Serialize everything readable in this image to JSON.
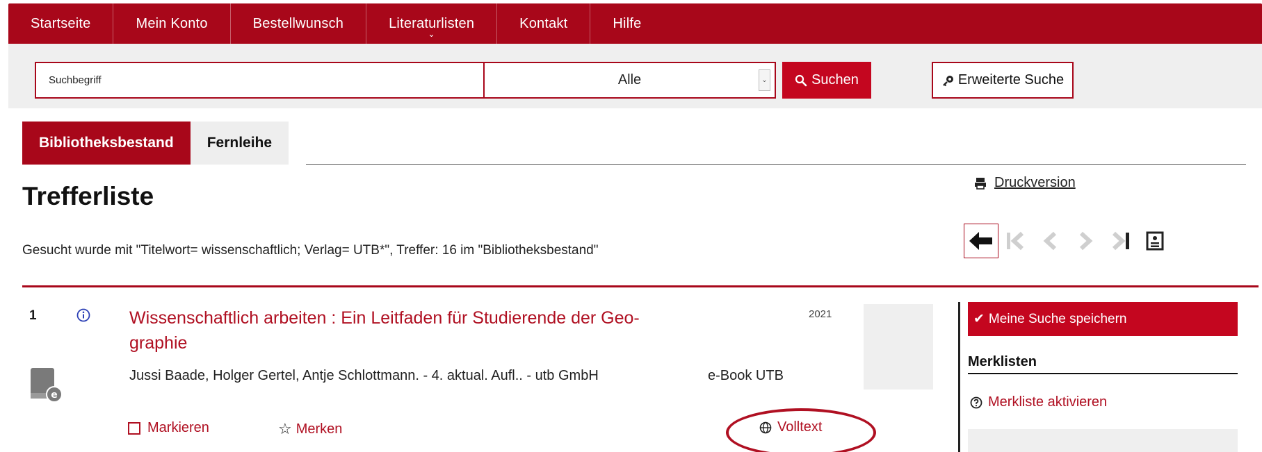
{
  "nav": {
    "items": [
      {
        "label": "Startseite"
      },
      {
        "label": "Mein Konto"
      },
      {
        "label": "Bestellwunsch"
      },
      {
        "label": "Literaturlisten"
      },
      {
        "label": "Kontakt"
      },
      {
        "label": "Hilfe"
      }
    ]
  },
  "search": {
    "input_value": "Suchbegriff",
    "select_value": "Alle",
    "submit_label": "Suchen",
    "advanced_label": "Erweiterte Suche"
  },
  "tabs": [
    {
      "label": "Bibliotheksbestand",
      "active": true
    },
    {
      "label": "Fernleihe",
      "active": false
    }
  ],
  "page": {
    "title": "Trefferliste",
    "print_label": "Druckversion",
    "query_summary": "Gesucht wurde mit \"Titelwort= wissenschaftlich; Verlag= UTB*\", Treffer: 16 im \"Bibliotheksbestand\""
  },
  "result": {
    "number": "1",
    "title": "Wissenschaftlich arbeiten : Ein Leitfaden für Studierende der Geo- graphie",
    "year": "2021",
    "authors": "Jussi Baade, Holger Gertel, Antje Schlottmann. - 4. aktual. Aufl.. - utb GmbH",
    "type": "e-Book UTB",
    "mark_label": "Markieren",
    "merk_label": "Merken",
    "fulltext_label": "Volltext"
  },
  "sidebar": {
    "save_search_label": "Meine Suche speichern",
    "merklisten_heading": "Merklisten",
    "activate_label": "Merkliste aktivieren"
  },
  "colors": {
    "brand": "#a8071a",
    "button": "#c4061f",
    "link": "#b01022"
  }
}
